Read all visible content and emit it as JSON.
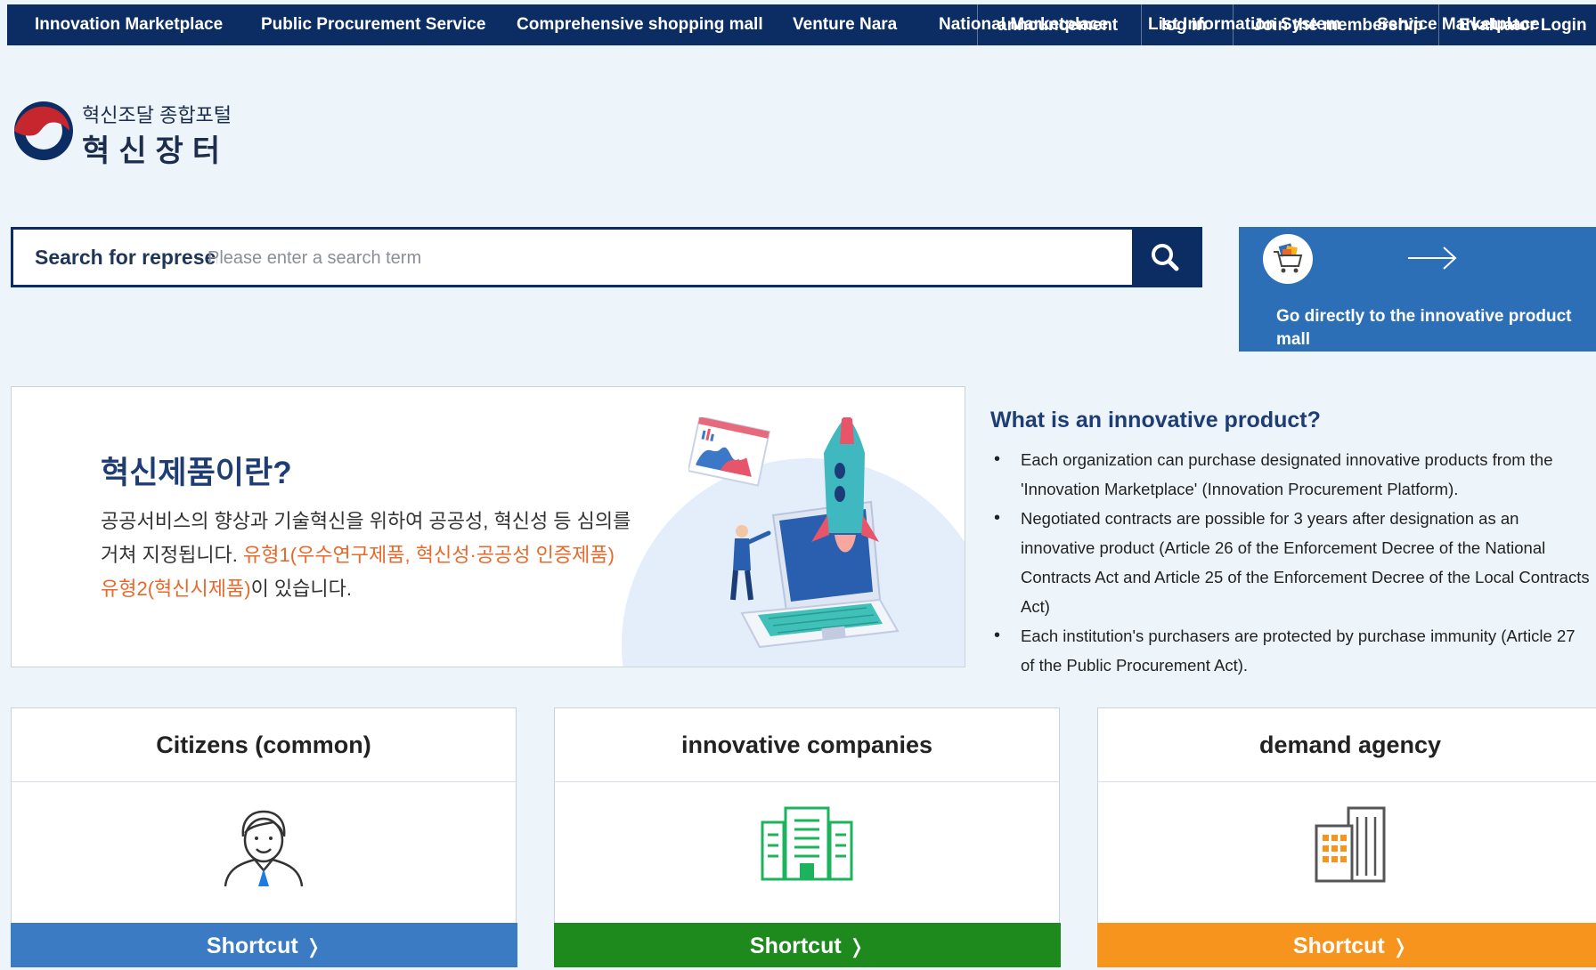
{
  "topnav": {
    "items": [
      {
        "label": "Innovation Marketplace"
      },
      {
        "label": "Public Procurement Service"
      },
      {
        "label": "Comprehensive shopping mall"
      },
      {
        "label": "Venture Nara"
      },
      {
        "label": "National Marketplace"
      },
      {
        "label": "List Information System"
      },
      {
        "label": "Service Marketplace"
      }
    ],
    "utility": [
      {
        "label": "announcement"
      },
      {
        "label": "log in"
      },
      {
        "label": "Join the membership"
      },
      {
        "label": "Evaluator Login"
      }
    ]
  },
  "logo": {
    "subtitle": "혁신조달 종합포털",
    "title": "혁신장터"
  },
  "search": {
    "label": "Search for representative product",
    "placeholder": "Please enter a search term",
    "value": ""
  },
  "mall_shortcut": {
    "text": "Go directly to the innovative product mall"
  },
  "banner": {
    "title": "혁신제품이란?",
    "desc_plain": "공공서비스의 향상과 기술혁신을 위하여 공공성, 혁신성 등 심의를 거쳐 지정됩니다. ",
    "desc_highlight_1": "유형1(우수연구제품, 혁신성·공공성 인증제품) 유형2(혁신시제품)",
    "desc_end": "이 있습니다."
  },
  "info": {
    "title": "What is an innovative product?",
    "bullets": [
      "Each organization can purchase designated innovative products from the 'Innovation Marketplace' (Innovation Procurement Platform).",
      "Negotiated contracts are possible for 3 years after designation as an innovative product (Article 26 of the Enforcement Decree of the National Contracts Act and Article 25 of the Enforcement Decree of the Local Contracts Act)",
      "Each institution's purchasers are protected by purchase immunity (Article 27 of the Public Procurement Act)."
    ]
  },
  "cards": [
    {
      "title": "Citizens (common)",
      "button": "Shortcut",
      "color": "#3b7bc4"
    },
    {
      "title": "innovative companies",
      "button": "Shortcut",
      "color": "#1e8a1e"
    },
    {
      "title": "demand agency",
      "button": "Shortcut",
      "color": "#f7941d"
    }
  ],
  "colors": {
    "nav_bg": "#0c2d63",
    "mall_bg": "#2c6fb7",
    "highlight": "#e8692b",
    "heading": "#1f3d75"
  }
}
